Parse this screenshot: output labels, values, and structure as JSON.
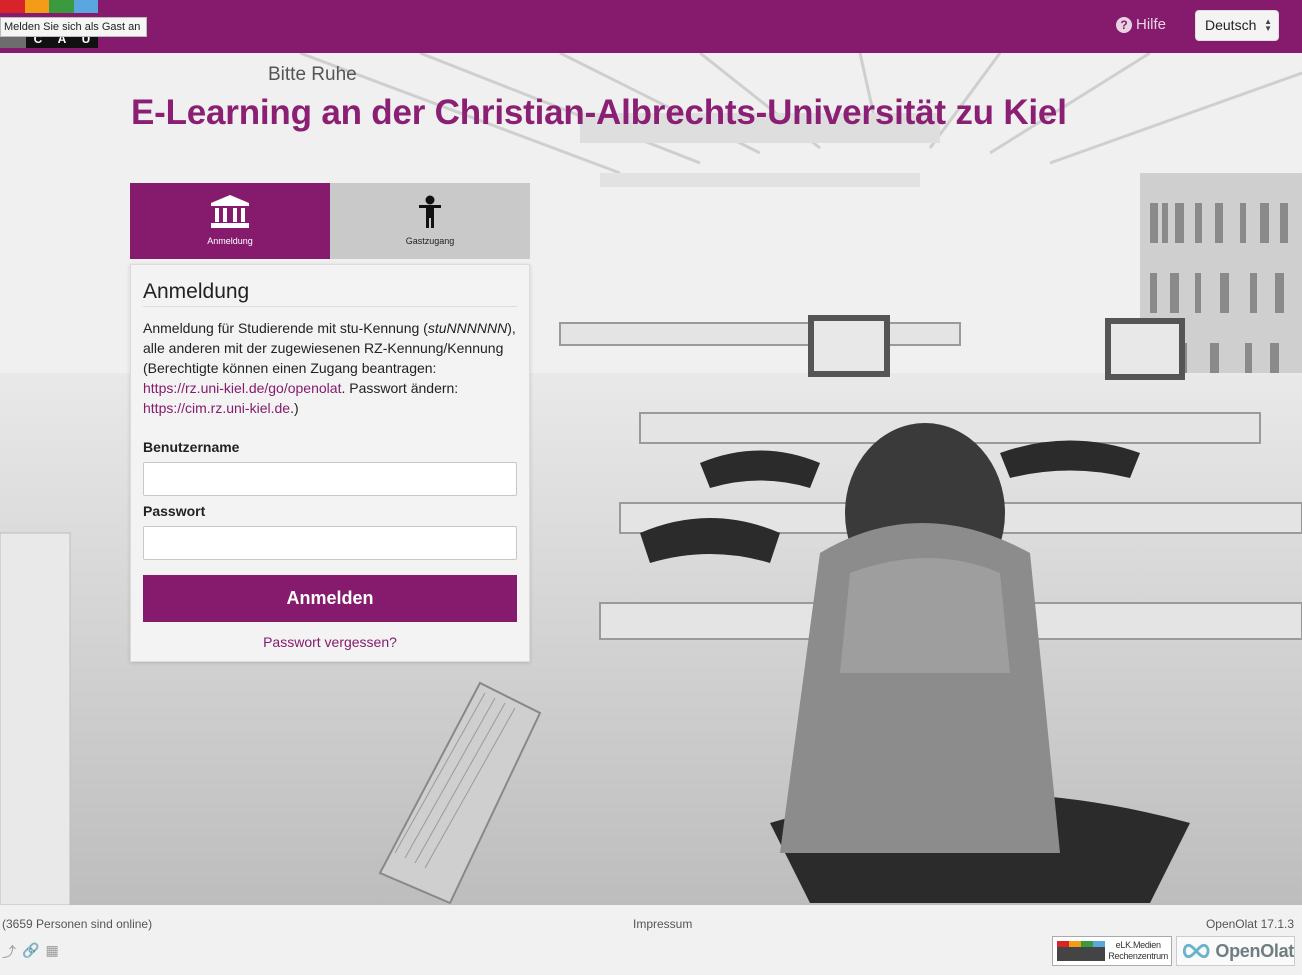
{
  "header": {
    "logo_letters": [
      "C",
      "A",
      "U"
    ],
    "logo_colors": [
      "#d9232a",
      "#f39c1a",
      "#3a9a3d",
      "#5aa7df"
    ],
    "guest_tooltip": "Melden Sie sich als Gast an",
    "help_label": "Hilfe",
    "language": "Deutsch"
  },
  "background": {
    "sign_text": "Bitte Ruhe"
  },
  "page_title": "E-Learning an der Christian-Albrechts-Universität zu Kiel",
  "tabs": [
    {
      "label": "Anmeldung",
      "icon": "bank-icon",
      "active": true
    },
    {
      "label": "Gastzugang",
      "icon": "person-icon",
      "active": false
    }
  ],
  "login": {
    "heading": "Anmeldung",
    "desc_part1": "Anmeldung für Studierende mit stu-Kennung (",
    "desc_italic": "stuNNNNNN",
    "desc_part2": "), alle anderen mit der zugewiesenen RZ-Kennung/Kennung (Berechtigte können einen Zugang beantragen: ",
    "link1": "https://rz.uni-kiel.de/go/openolat",
    "desc_part3": ". Passwort ändern: ",
    "link2": "https://cim.rz.uni-kiel.de",
    "desc_part4": ".)",
    "username_label": "Benutzername",
    "username_value": "",
    "password_label": "Passwort",
    "password_value": "",
    "submit_label": "Anmelden",
    "forgot_label": "Passwort vergessen?"
  },
  "footer": {
    "online_text": "(3659 Personen sind online)",
    "impressum": "Impressum",
    "version": "OpenOlat 17.1.3",
    "elk_line1": "eLK.Medien",
    "elk_line2": "Rechenzentrum",
    "openolat_logo": "OpenOlat"
  },
  "colors": {
    "brand": "#861b6e",
    "tab_inactive": "#c9c9c9"
  }
}
